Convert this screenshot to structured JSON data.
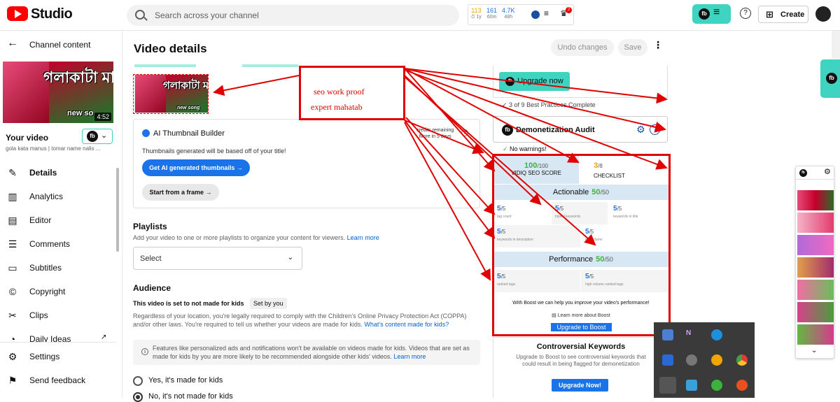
{
  "header": {
    "logo_text": "Studio",
    "search_placeholder": "Search across your channel",
    "stats": [
      {
        "value": "113",
        "label": "⏱ 1y",
        "color": "#f0a500"
      },
      {
        "value": "161",
        "label": "60m",
        "color": "#1a73e8"
      },
      {
        "value": "4.7K",
        "label": "48h",
        "color": "#1a73e8"
      }
    ],
    "notification_badge": "2",
    "create_label": "Create"
  },
  "sidebar": {
    "back_label": "Channel content",
    "thumb_title": "গলাকাটা মানুষ",
    "thumb_tag": "new so",
    "duration": "4:52",
    "your_video_label": "Your video",
    "video_subtitle": "gola kata manus | tomar name nalis ...",
    "nav": [
      {
        "label": "Details",
        "icon": "pencil-icon",
        "glyph": "✎",
        "active": true
      },
      {
        "label": "Analytics",
        "icon": "analytics-icon",
        "glyph": "▥",
        "active": false
      },
      {
        "label": "Editor",
        "icon": "film-icon",
        "glyph": "▤",
        "active": false
      },
      {
        "label": "Comments",
        "icon": "comments-icon",
        "glyph": "☰",
        "active": false
      },
      {
        "label": "Subtitles",
        "icon": "subtitles-icon",
        "glyph": "▭",
        "active": false
      },
      {
        "label": "Copyright",
        "icon": "copyright-icon",
        "glyph": "©",
        "active": false
      },
      {
        "label": "Clips",
        "icon": "scissors-icon",
        "glyph": "✂",
        "active": false
      },
      {
        "label": "Daily Ideas",
        "icon": "ideas-icon",
        "glyph": "◔",
        "active": false
      }
    ],
    "settings_label": "Settings",
    "feedback_label": "Send feedback"
  },
  "main": {
    "title": "Video details",
    "undo_label": "Undo changes",
    "save_label": "Save",
    "thumb_title": "গলাকাটা মানুষ",
    "thumb_tag": "new song",
    "ai": {
      "title": "AI Thumbnail Builder",
      "desc": "Thumbnails generated will be based off of your title!",
      "primary_label": "Get AI generated thumbnails →",
      "secondary_label": "Start from a frame →",
      "credits_line1": "credits remaining",
      "credits_line2": "More in 5 days"
    },
    "playlists": {
      "heading": "Playlists",
      "desc": "Add your video to one or more playlists to organize your content for viewers.",
      "learn_more": "Learn more",
      "select_value": "Select"
    },
    "audience": {
      "heading": "Audience",
      "status": "This video is set to not made for kids",
      "set_by": "Set by you",
      "desc1": "Regardless of your location, you're legally required to comply with the Children's Online Privacy Protection Act (COPPA)",
      "desc2": "and/or other laws. You're required to tell us whether your videos are made for kids.",
      "desc_link": "What's content made for kids?",
      "info": "Features like personalized ads and notifications won't be available on videos made for kids. Videos that are set as made for kids by you are more likely to be recommended alongside other kids' videos.",
      "info_link": "Learn more",
      "radio_yes": "Yes, it's made for kids",
      "radio_no": "No, it's not made for kids"
    }
  },
  "vidiq_panel": {
    "upgrade_now_label": "Upgrade now",
    "best_practices": "3 of 9 Best Practices Complete",
    "demonetization_title": "Demonetization Audit",
    "no_warnings": "No warnings!",
    "seo_score": "100",
    "seo_max": "/100",
    "seo_label": "VIDIQ SEO SCORE",
    "checklist_score": "3",
    "checklist_max": "/8",
    "checklist_label": "CHECKLIST",
    "actionable_label": "Actionable",
    "actionable_score": "50",
    "actionable_max": "/50",
    "metrics_actionable": [
      {
        "value": "5",
        "max": "/5",
        "caption": "tag count"
      },
      {
        "value": "5",
        "max": "/5",
        "caption": "tripled keywords"
      },
      {
        "value": "5",
        "max": "/5",
        "caption": "keywords in title"
      },
      {
        "value": "5",
        "max": "/5",
        "caption": "keywords in description"
      },
      {
        "value": "5",
        "max": "/5",
        "caption": "tag volume"
      }
    ],
    "performance_label": "Performance",
    "performance_score": "50",
    "performance_max": "/50",
    "metrics_performance": [
      {
        "value": "5",
        "max": "/5",
        "caption": "ranked tags"
      },
      {
        "value": "5",
        "max": "/5",
        "caption": "high volume ranked tags"
      }
    ],
    "boost_text": "With Boost we can help you improve your video's performance!",
    "boost_learn": "Learn more about Boost",
    "boost_btn": "Upgrade to Boost",
    "controversial_title": "Controversial Keywords",
    "controversial_desc": "Upgrade to Boost to see controversial keywords that could result in being flagged for demonetization",
    "controversial_btn": "Upgrade Now!"
  },
  "annotation": {
    "line1": "seo work proof",
    "line2": "expert mahatab",
    "color": "#e00000"
  }
}
